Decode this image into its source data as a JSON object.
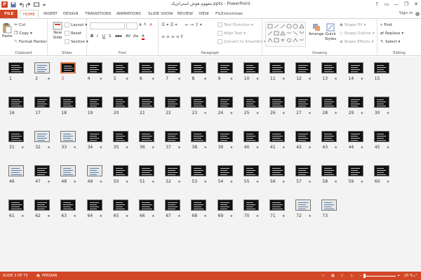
{
  "window": {
    "title": "مفهوم هوش استراتژیک.pptx - PowerPoint",
    "help": "?",
    "minimize": "—",
    "restore": "❐",
    "close": "✕"
  },
  "tabs": [
    "FILE",
    "HOME",
    "INSERT",
    "DESIGN",
    "TRANSITIONS",
    "ANIMATIONS",
    "SLIDE SHOW",
    "REVIEW",
    "VIEW",
    "FILEminimizer"
  ],
  "active_tab": "HOME",
  "signin": "Sign in",
  "ribbon": {
    "clipboard": {
      "paste": "Paste",
      "cut": "Cut",
      "copy": "Copy",
      "format_painter": "Format Painter",
      "label": "Clipboard"
    },
    "slides": {
      "new_slide": "New Slide",
      "layout": "Layout",
      "reset": "Reset",
      "section": "Section",
      "label": "Slides"
    },
    "font": {
      "bold": "B",
      "italic": "I",
      "underline": "U",
      "strike": "S",
      "shadow": "abc",
      "spacing": "AV",
      "case": "Aa",
      "color": "A",
      "grow": "A",
      "shrink": "A",
      "clear": "A",
      "label": "Font"
    },
    "paragraph": {
      "text_direction": "Text Direction",
      "align_text": "Align Text",
      "convert": "Convert to SmartArt",
      "label": "Paragraph"
    },
    "drawing": {
      "arrange": "Arrange",
      "quick_styles": "Quick Styles",
      "shape_fill": "Shape Fill",
      "shape_outline": "Shape Outline",
      "shape_effects": "Shape Effects",
      "label": "Drawing"
    },
    "editing": {
      "find": "Find",
      "replace": "Replace",
      "select": "Select",
      "label": "Editing"
    }
  },
  "slides_grid": {
    "count": 73,
    "selected": 3,
    "per_row": 15,
    "numbers": [
      "1",
      "2",
      "3",
      "4",
      "5",
      "6",
      "7",
      "8",
      "9",
      "10",
      "11",
      "12",
      "13",
      "14",
      "15",
      "16",
      "17",
      "18",
      "19",
      "20",
      "21",
      "22",
      "23",
      "24",
      "25",
      "26",
      "27",
      "28",
      "29",
      "30",
      "31",
      "32",
      "33",
      "34",
      "35",
      "36",
      "37",
      "38",
      "39",
      "40",
      "41",
      "42",
      "43",
      "44",
      "45",
      "46",
      "47",
      "48",
      "49",
      "50",
      "51",
      "52",
      "53",
      "54",
      "55",
      "56",
      "57",
      "58",
      "59",
      "60",
      "61",
      "62",
      "63",
      "64",
      "65",
      "66",
      "67",
      "68",
      "69",
      "70",
      "71",
      "72",
      "73"
    ],
    "star": "★",
    "no_star": [
      "1",
      "3",
      "15",
      "16",
      "17",
      "18",
      "19",
      "20",
      "21",
      "22",
      "46",
      "73"
    ]
  },
  "status": {
    "slide": "SLIDE 3 OF 73",
    "language": "PERSIAN",
    "zoom": "20 %",
    "zoom_out": "−",
    "zoom_in": "+"
  },
  "colors": {
    "accent": "#d24726",
    "selected_border": "#e86f3a",
    "workspace": "#f3f3f3"
  }
}
